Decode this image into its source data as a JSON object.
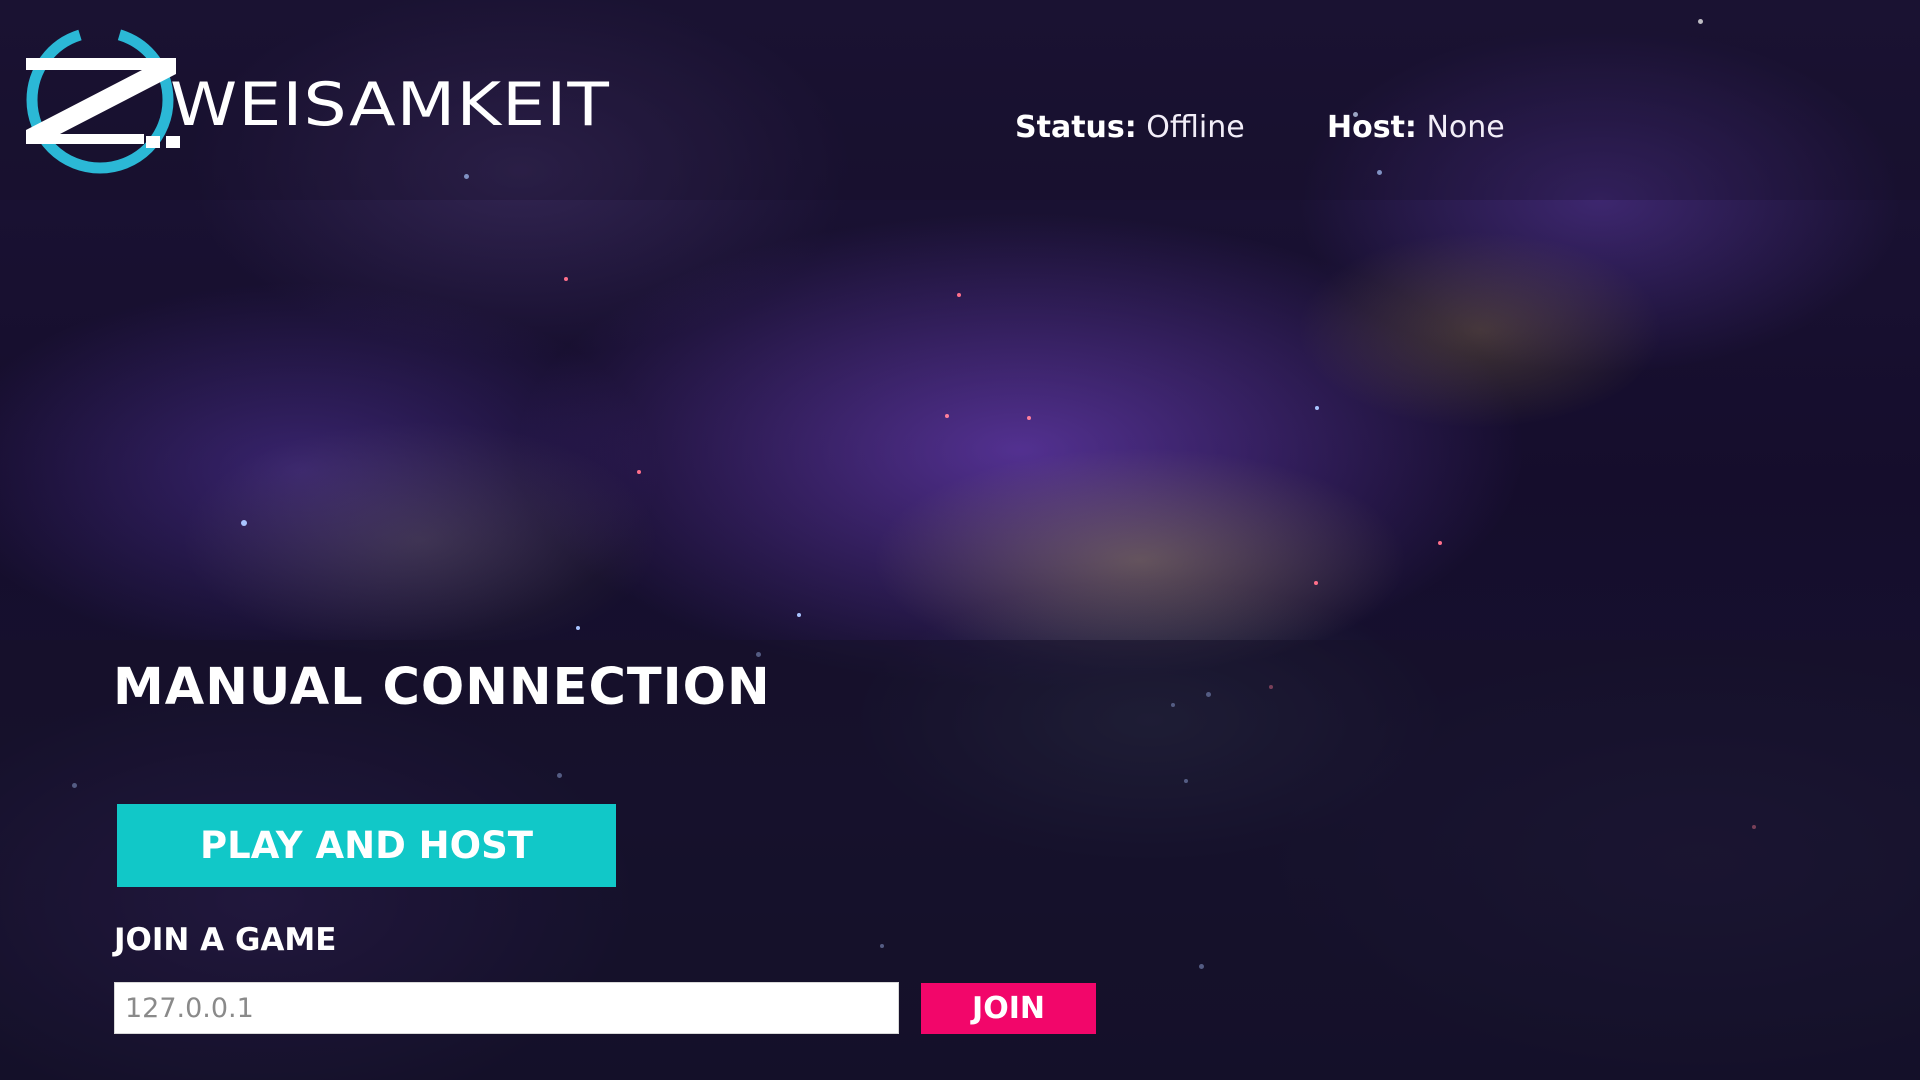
{
  "app": {
    "logo_text": "ZWEISAMKEIT",
    "logo_icon": "z-ring-logo-icon"
  },
  "header": {
    "status_label": "Status:",
    "status_value": "Offline",
    "host_label": "Host:",
    "host_value": "None"
  },
  "manual_connection": {
    "title": "MANUAL CONNECTION",
    "play_and_host_label": "PLAY AND HOST",
    "join_section_label": "JOIN A GAME",
    "address_value": "127.0.0.1",
    "join_button_label": "JOIN"
  },
  "colors": {
    "play_host_button": "#11c8c8",
    "join_button": "#f2066a",
    "logo_ring": "#2bb8d6",
    "background_nebula": "#1c1436"
  }
}
